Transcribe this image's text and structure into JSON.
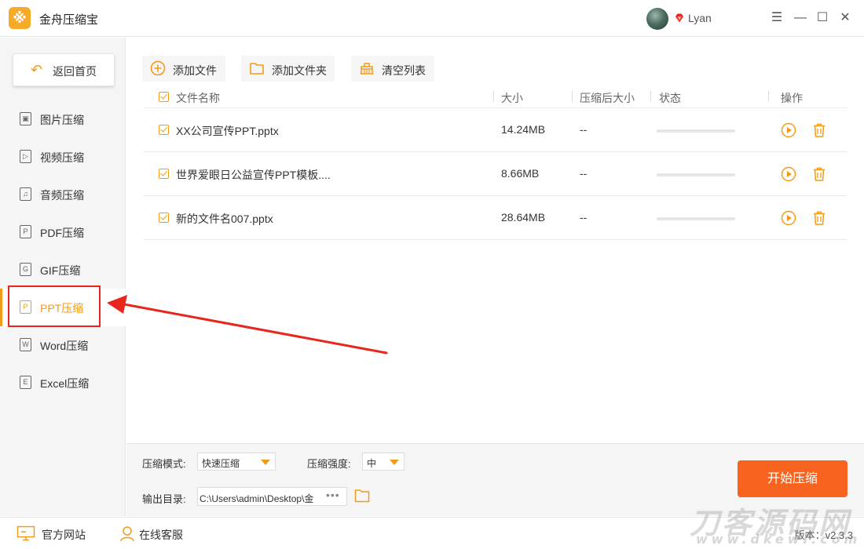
{
  "app": {
    "title": "金舟压缩宝",
    "logo_glyph": "※",
    "user_name": "Lyan",
    "accent": "#f29b18",
    "start_color": "#f8641f",
    "highlight_color": "#e8261e"
  },
  "window_controls": {
    "menu": "☰",
    "minimize": "—",
    "maximize": "☐",
    "close": "✕"
  },
  "sidebar": {
    "back_label": "返回首页",
    "items": [
      {
        "label": "图片压缩",
        "icon": "image-file-icon",
        "glyph": "▣"
      },
      {
        "label": "视频压缩",
        "icon": "video-file-icon",
        "glyph": "▷"
      },
      {
        "label": "音频压缩",
        "icon": "audio-file-icon",
        "glyph": "♫"
      },
      {
        "label": "PDF压缩",
        "icon": "pdf-file-icon",
        "glyph": "P"
      },
      {
        "label": "GIF压缩",
        "icon": "gif-file-icon",
        "glyph": "G"
      },
      {
        "label": "PPT压缩",
        "icon": "ppt-file-icon",
        "glyph": "P",
        "active": true
      },
      {
        "label": "Word压缩",
        "icon": "word-file-icon",
        "glyph": "W"
      },
      {
        "label": "Excel压缩",
        "icon": "excel-file-icon",
        "glyph": "E"
      }
    ]
  },
  "toolbar": {
    "add_file": "添加文件",
    "add_folder": "添加文件夹",
    "clear_list": "清空列表"
  },
  "table": {
    "headers": {
      "name": "文件名称",
      "size": "大小",
      "compressed_size": "压缩后大小",
      "status": "状态",
      "action": "操作"
    },
    "rows": [
      {
        "name": "XX公司宣传PPT.pptx",
        "size": "14.24MB",
        "compressed": "--",
        "progress": 0
      },
      {
        "name": "世界爱眼日公益宣传PPT模板....",
        "size": "8.66MB",
        "compressed": "--",
        "progress": 0
      },
      {
        "name": "新的文件名007.pptx",
        "size": "28.64MB",
        "compressed": "--",
        "progress": 0
      }
    ]
  },
  "settings": {
    "mode_label": "压缩模式:",
    "mode_value": "快速压缩",
    "strength_label": "压缩强度:",
    "strength_value": "中",
    "output_label": "输出目录:",
    "output_path": "C:\\Users\\admin\\Desktop\\金",
    "more": "•••",
    "start_label": "开始压缩"
  },
  "footer": {
    "website": "官方网站",
    "support": "在线客服",
    "version": "版本：v2.3.3"
  },
  "watermark": {
    "text": "刀客源码网",
    "url": "www.dkewl.com"
  }
}
